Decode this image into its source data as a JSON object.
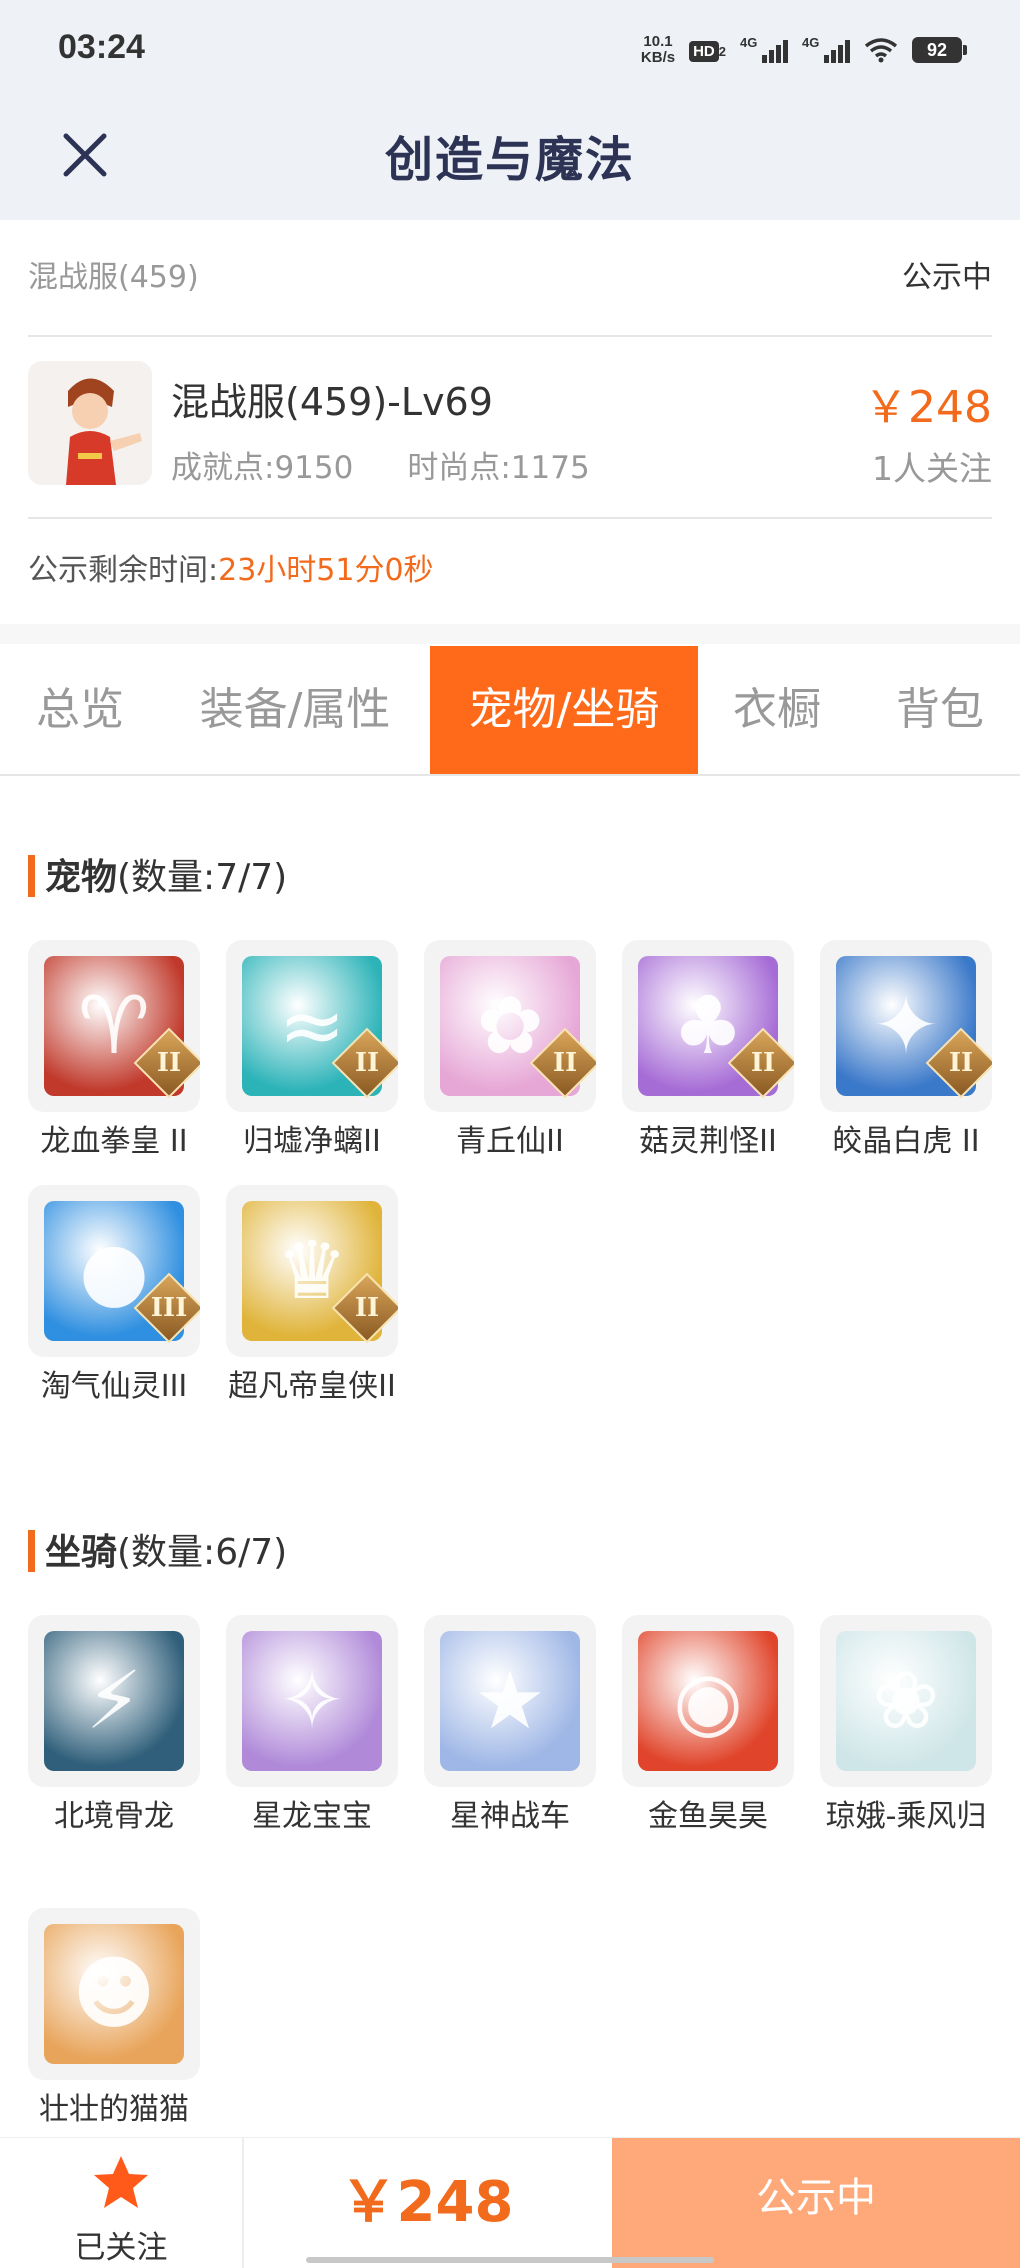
{
  "status_bar": {
    "time": "03:24",
    "net_speed_value": "10.1",
    "net_speed_unit": "KB/s",
    "hd_label": "HD",
    "hd_sub": "2",
    "signal1_label": "4G",
    "signal2_label": "4G",
    "battery": "92"
  },
  "header": {
    "title": "创造与魔法",
    "close_icon": "close-icon"
  },
  "listing": {
    "server": "混战服(459)",
    "status": "公示中",
    "character_name": "混战服(459)-Lv69",
    "achievement_points": "成就点:9150",
    "fashion_points": "时尚点:1175",
    "price": "￥248",
    "followers": "1人关注",
    "countdown_label": "公示剩余时间:",
    "countdown_value": "23小时51分0秒"
  },
  "tabs": [
    {
      "label": "总览",
      "active": false
    },
    {
      "label": "装备/属性",
      "active": false
    },
    {
      "label": "宠物/坐骑",
      "active": true
    },
    {
      "label": "衣橱",
      "active": false
    },
    {
      "label": "背包",
      "active": false
    }
  ],
  "pets": {
    "title": "宠物",
    "count": "(数量:7/7)",
    "items": [
      {
        "name": "龙血拳皇 II",
        "grade": "II",
        "color": "#c0392b",
        "icon": "ram-beast-icon"
      },
      {
        "name": "归墟净螭II",
        "grade": "II",
        "color": "#2bb3b8",
        "icon": "sea-dragon-icon"
      },
      {
        "name": "青丘仙II",
        "grade": "II",
        "color": "#e6a6d6",
        "icon": "fox-fairy-icon"
      },
      {
        "name": "菇灵荆怪II",
        "grade": "II",
        "color": "#a66cd6",
        "icon": "mushroom-sprite-icon"
      },
      {
        "name": "皎晶白虎 II",
        "grade": "II",
        "color": "#3a78c9",
        "icon": "white-tiger-icon"
      },
      {
        "name": "淘气仙灵III",
        "grade": "III",
        "color": "#2f8fe0",
        "icon": "puppy-sprite-icon"
      },
      {
        "name": "超凡帝皇侠II",
        "grade": "II",
        "color": "#e0b43a",
        "icon": "emperor-knight-icon"
      }
    ]
  },
  "mounts": {
    "title": "坐骑",
    "count": "(数量:6/7)",
    "items": [
      {
        "name": "北境骨龙",
        "color": "#2f5f7a",
        "icon": "bone-dragon-icon"
      },
      {
        "name": "星龙宝宝",
        "color": "#b08ad9",
        "icon": "baby-star-dragon-icon"
      },
      {
        "name": "星神战车",
        "color": "#9fb7e6",
        "icon": "star-chariot-icon"
      },
      {
        "name": "金鱼昊昊",
        "color": "#e0452b",
        "icon": "goldfish-icon"
      },
      {
        "name": "琼娥-乘风归",
        "color": "#cfe6e8",
        "icon": "fairy-maiden-icon"
      },
      {
        "name": "壮壮的猫猫",
        "color": "#e8a45a",
        "icon": "cat-icon"
      }
    ]
  },
  "bottom_bar": {
    "follow_label": "已关注",
    "price": "￥248",
    "action_label": "公示中",
    "star_color": "#ff5a1a"
  }
}
